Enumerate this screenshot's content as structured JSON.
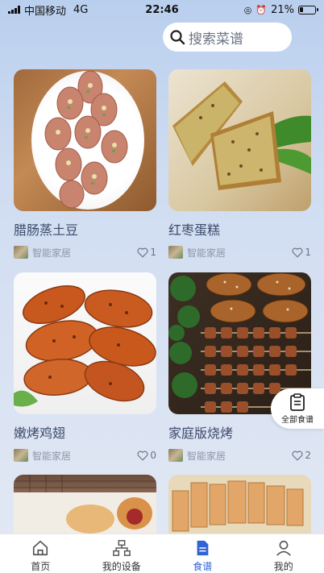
{
  "status_bar": {
    "carrier": "中国移动",
    "network": "4G",
    "time": "22:46",
    "battery": "21%"
  },
  "search": {
    "placeholder": "搜索菜谱"
  },
  "recipes": [
    {
      "title": "腊肠蒸土豆",
      "author": "智能家居",
      "likes": "1"
    },
    {
      "title": "红枣蛋糕",
      "author": "智能家居",
      "likes": "1"
    },
    {
      "title": "嫩烤鸡翅",
      "author": "智能家居",
      "likes": "0"
    },
    {
      "title": "家庭版烧烤",
      "author": "智能家居",
      "likes": "2"
    }
  ],
  "floating_button": {
    "label": "全部食谱"
  },
  "bottom_nav": {
    "items": [
      {
        "label": "首页"
      },
      {
        "label": "我的设备"
      },
      {
        "label": "食谱"
      },
      {
        "label": "我的"
      }
    ],
    "active_index": 2
  },
  "colors": {
    "accent": "#2f64d6",
    "title_text": "#3c4a6a"
  }
}
